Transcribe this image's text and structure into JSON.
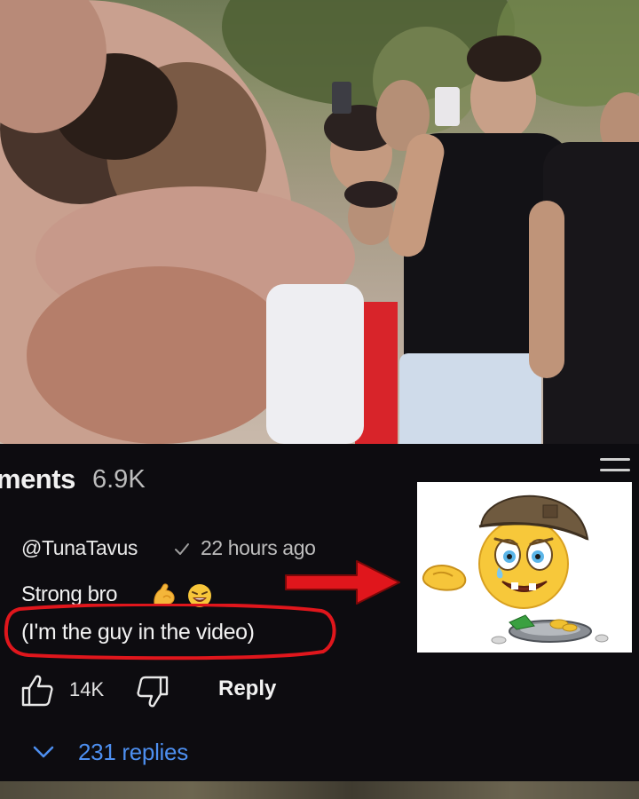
{
  "comments": {
    "header_title": "ments",
    "header_count": "6.9K"
  },
  "comment": {
    "author": "@TunaTavus",
    "time": "22 hours ago",
    "line1": "Strong bro",
    "line2": "(I'm the guy in the video)",
    "likes": "14K",
    "reply_label": "Reply",
    "replies_label": "231 replies"
  },
  "icons": {
    "menu": "menu-icon",
    "verified": "checkmark-icon",
    "flexed_biceps_emoji": "flexed-biceps-emoji-icon",
    "laughing_emoji": "laughing-emoji-icon",
    "like": "thumbs-up-icon",
    "dislike": "thumbs-down-icon",
    "chevron": "chevron-down-icon"
  },
  "colors": {
    "panel_background": "#0d0c10",
    "link_blue": "#4d8ff0",
    "annotation_red": "#e0161c"
  }
}
